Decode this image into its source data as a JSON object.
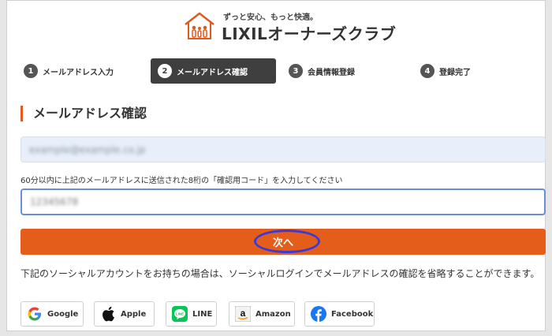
{
  "header": {
    "tagline": "ずっと安心、もっと快適。",
    "brand": "LIXILオーナーズクラブ"
  },
  "steps": [
    {
      "num": "1",
      "label": "メールアドレス入力",
      "active": false
    },
    {
      "num": "2",
      "label": "メールアドレス確認",
      "active": true
    },
    {
      "num": "3",
      "label": "会員情報登録",
      "active": false
    },
    {
      "num": "4",
      "label": "登録完了",
      "active": false
    }
  ],
  "main": {
    "title": "メールアドレス確認",
    "email_value": "example@example.co.jp",
    "hint": "60分以内に上記のメールアドレスに送信された8桁の「確認用コード」を入力してください",
    "code_value": "12345678",
    "next_label": "次へ",
    "social_desc": "下記のソーシャルアカウントをお持ちの場合は、ソーシャルログインでメールアドレスの確認を省略することができます。"
  },
  "social": [
    {
      "label": "Google",
      "icon": "google-icon"
    },
    {
      "label": "Apple",
      "icon": "apple-icon"
    },
    {
      "label": "LINE",
      "icon": "line-icon"
    },
    {
      "label": "Amazon",
      "icon": "amazon-icon"
    },
    {
      "label": "Facebook",
      "icon": "facebook-icon"
    }
  ],
  "colors": {
    "accent": "#e45d1a",
    "active_step": "#3f3f3f",
    "highlight": "#3a3ad8",
    "input_focus": "#6b8fd6"
  }
}
